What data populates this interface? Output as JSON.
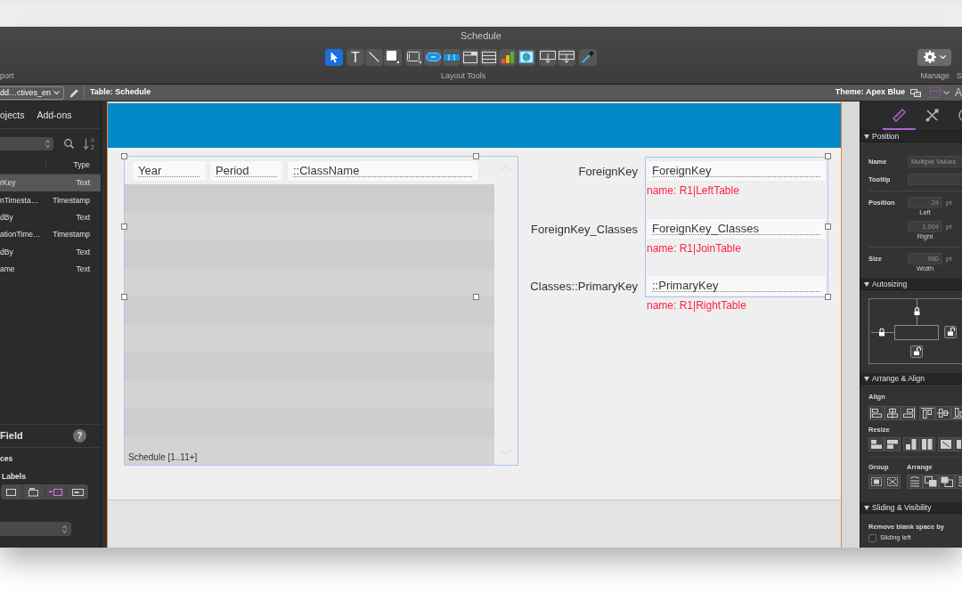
{
  "window": {
    "title": "Schedule"
  },
  "toolbar": {
    "tool_groups": [
      {
        "tools": [
          {
            "kind": "pointer",
            "selected": true
          }
        ]
      },
      {
        "tools": [
          {
            "kind": "text",
            "glyph": "T",
            "selected": false
          },
          {
            "kind": "line",
            "selected": false
          },
          {
            "kind": "rectangle",
            "selected": false
          }
        ]
      },
      {
        "tools": [
          {
            "kind": "field",
            "selected": false
          },
          {
            "kind": "button",
            "selected": false
          },
          {
            "kind": "button-bar",
            "selected": false
          },
          {
            "kind": "popover",
            "selected": false
          },
          {
            "kind": "portal",
            "selected": false
          },
          {
            "kind": "chart",
            "selected": false
          },
          {
            "kind": "web-viewer",
            "selected": false
          }
        ]
      },
      {
        "tools": [
          {
            "kind": "field-picker",
            "selected": false
          },
          {
            "kind": "part",
            "selected": false
          }
        ]
      },
      {
        "tools": [
          {
            "kind": "eyedropper",
            "selected": false
          }
        ]
      }
    ],
    "left_label": "port",
    "center_label": "Layout Tools",
    "right_label": "Manage",
    "edge_label": "S"
  },
  "layout_bar": {
    "layout_menu": "dd…ctives_en",
    "table": "Table: Schedule",
    "theme": "Theme: Apex Blue",
    "edge_label": "A"
  },
  "fields_pane": {
    "tabs": [
      "ojects",
      "Add-ons"
    ],
    "column": "Type",
    "fields": [
      {
        "name": "rKey",
        "type": "Text",
        "selected": true
      },
      {
        "name": "nTimesta…",
        "type": "Timestamp",
        "selected": false
      },
      {
        "name": "dBy",
        "type": "Text",
        "selected": false
      },
      {
        "name": "ationTime…",
        "type": "Timestamp",
        "selected": false
      },
      {
        "name": "dBy",
        "type": "Text",
        "selected": false
      },
      {
        "name": "ame",
        "type": "Text",
        "selected": false
      }
    ],
    "section": "Field",
    "help": "?",
    "subsection": "ces",
    "labels_title": "Labels",
    "label_positions": [
      {
        "kind": "none",
        "selected": false
      },
      {
        "kind": "above",
        "selected": false
      },
      {
        "kind": "left",
        "selected": true
      },
      {
        "kind": "inside",
        "selected": false
      }
    ]
  },
  "layout": {
    "portal": {
      "columns": [
        "Year",
        "Period",
        "::ClassName"
      ],
      "caption": "Schedule [1..11+]"
    },
    "fields": [
      {
        "label": "ForeignKey",
        "value": "ForeignKey",
        "note": "name: R1|LeftTable"
      },
      {
        "label": "ForeignKey_Classes",
        "value": "ForeignKey_Classes",
        "note": "name: R1|JoinTable"
      },
      {
        "label": "Classes::PrimaryKey",
        "value": "::PrimaryKey",
        "note": "name: R1|RightTable"
      }
    ]
  },
  "inspector": {
    "tabs": [
      {
        "kind": "ruler",
        "selected": true
      },
      {
        "kind": "tools",
        "selected": false
      },
      {
        "kind": "palette",
        "selected": false
      }
    ],
    "position": {
      "title": "Position",
      "expanded": true,
      "name_label": "Name",
      "name_placeholder": "Multiple Values",
      "tooltip_label": "Tooltip",
      "position_label": "Position",
      "left": {
        "value": "24",
        "unit": "pt",
        "caption": "Left",
        "disabled": true
      },
      "right": {
        "value": "1,004",
        "unit": "pt",
        "caption": "Right",
        "disabled": true
      },
      "size_label": "Size",
      "width": {
        "value": "980",
        "unit": "pt",
        "caption": "Width",
        "disabled": true
      }
    },
    "autosizing": {
      "title": "Autosizing",
      "expanded": true,
      "anchors": [
        {
          "kind": "top",
          "locked": true
        },
        {
          "kind": "left",
          "locked": true
        },
        {
          "kind": "right",
          "locked": false
        },
        {
          "kind": "bottom",
          "locked": false
        }
      ]
    },
    "arrange": {
      "title": "Arrange & Align",
      "expanded": true,
      "align_label": "Align",
      "resize_label": "Resize",
      "group_label": "Group",
      "arrange_label": "Arrange"
    },
    "sliding": {
      "title": "Sliding & Visibility",
      "expanded": true,
      "remove_label": "Remove blank space by",
      "options": [
        {
          "label": "Sliding left",
          "checked": false
        }
      ]
    }
  }
}
